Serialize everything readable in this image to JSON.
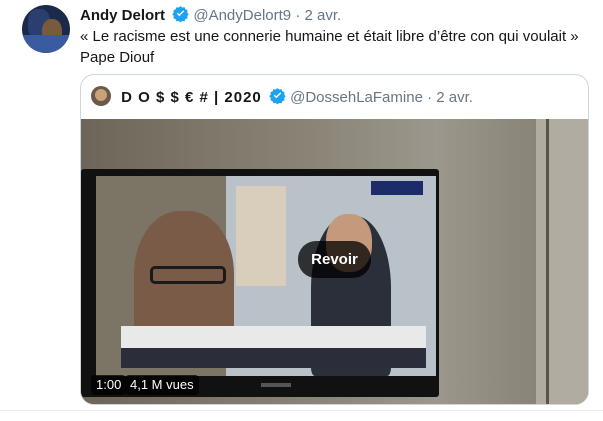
{
  "tweet": {
    "name": "Andy Delort",
    "handle": "@AndyDelort9",
    "separator": "·",
    "date": "2 avr.",
    "text": "« Le racisme est une connerie humaine et était libre d’être con qui voulait » Pape Diouf"
  },
  "quoted": {
    "name": "D O $ $ € # | 2020",
    "handle": "@DossehLaFamine",
    "separator": "·",
    "date": "2 avr.",
    "video": {
      "replay_label": "Revoir",
      "duration": "1:00",
      "views": "4,1 M vues"
    }
  },
  "colors": {
    "verified": "#1da1f2",
    "secondary_text": "#657786",
    "border": "#ccd6dd"
  }
}
